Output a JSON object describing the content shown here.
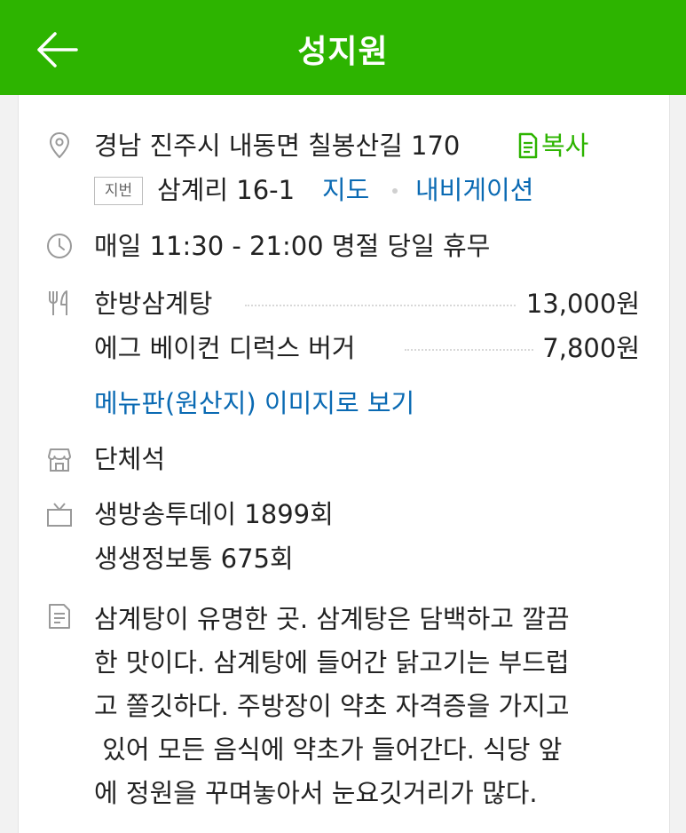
{
  "header": {
    "title": "성지원",
    "back_icon": "arrow-left-icon"
  },
  "address": {
    "road": "경남 진주시 내동면 칠봉산길 170",
    "copy_label": "복사",
    "jibun_badge": "지번",
    "jibun": "삼계리 16-1",
    "map_label": "지도",
    "navigation_label": "내비게이션"
  },
  "hours": {
    "text": "매일 11:30 - 21:00 명절 당일 휴무"
  },
  "menu": {
    "items": [
      {
        "name": "한방삼계탕",
        "price": "13,000원"
      },
      {
        "name": "에그 베이컨 디럭스 버거",
        "price": "7,800원"
      }
    ],
    "menu_image_link": "메뉴판(원산지) 이미지로 보기"
  },
  "facilities": {
    "text": "단체석"
  },
  "tv": {
    "lines": [
      "생방송투데이 1899회",
      "생생정보통 675회"
    ]
  },
  "description": {
    "lines": [
      "삼계탕이 유명한 곳. 삼계탕은 담백하고 깔끔",
      "한 맛이다. 삼계탕에 들어간 닭고기는 부드럽",
      "고 쫄깃하다. 주방장이 약초 자격증을 가지고",
      " 있어 모든 음식에 약초가 들어간다. 식당 앞",
      "에 정원을 꾸며놓아서 눈요깃거리가 많다."
    ]
  },
  "colors": {
    "brand": "#2db400",
    "link": "#0a6ab3"
  }
}
